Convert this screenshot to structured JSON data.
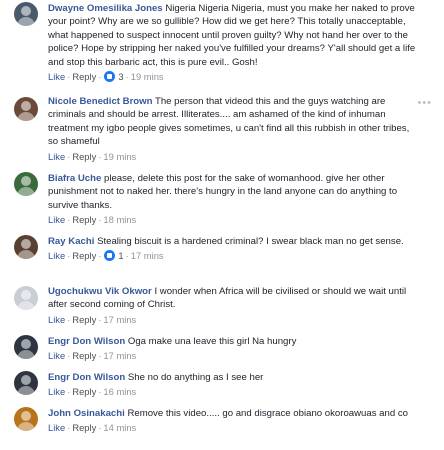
{
  "actions": {
    "like": "Like",
    "reply": "Reply",
    "sep": "·"
  },
  "more_icon": "more-options-icon",
  "comments": [
    {
      "author": "Dwayne Omesilika Jones",
      "text": "Nigeria Nigeria Nigeria, must you make her naked to prove your point? Why are we so gullible? How did we get here? This totally unacceptable, what happened to suspect innocent until proven guilty? Why not hand her over to the police? Hope by stripping her naked you've fulfilled your dreams? Y'all should get a life and stop this barbaric act, this is pure evil.. Gosh!",
      "reactions": "3",
      "time": "19 mins",
      "avatar_color": "#4a5a6a"
    },
    {
      "author": "Nicole Benedict Brown",
      "text": "The person that videod this and the guys watching are criminals and should be arrest. Illiterates.... am ashamed of the kind of inhuman treatment my igbo people gives sometimes, u can't find all this rubbish in other tribes, so shameful",
      "time": "19 mins",
      "avatar_color": "#6b4a3a"
    },
    {
      "author": "Biafra Uche",
      "text": "please, delete this post for the sake of womanhood. give her other punishment not to naked her. there's hungry in the land anyone can do anything to survive thanks.",
      "time": "18 mins",
      "avatar_color": "#3a6b3a"
    },
    {
      "author": "Ray Kachi",
      "text": "Stealing biscuit is a hardened criminal? I swear black man no get sense.",
      "reactions": "1",
      "time": "17 mins",
      "avatar_color": "#5a4030"
    },
    {
      "author": "Ugochukwu Vik Okwor",
      "text": "I wonder when Africa will be civilised or should we wait until after second coming of Christ.",
      "time": "17 mins",
      "avatar_color": "#c9cdd4"
    },
    {
      "author": "Engr Don Wilson",
      "text": "Oga make una leave this girl Na hungry",
      "time": "17 mins",
      "avatar_color": "#2e3440"
    },
    {
      "author": "Engr Don Wilson",
      "text": "She no do anything as I see her",
      "time": "16 mins",
      "avatar_color": "#2e3440"
    },
    {
      "author": "John Osinakachi",
      "text": "Remove this video..... go and disgrace obiano okoroawuas and co",
      "time": "14 mins",
      "avatar_color": "#b8741a"
    }
  ]
}
